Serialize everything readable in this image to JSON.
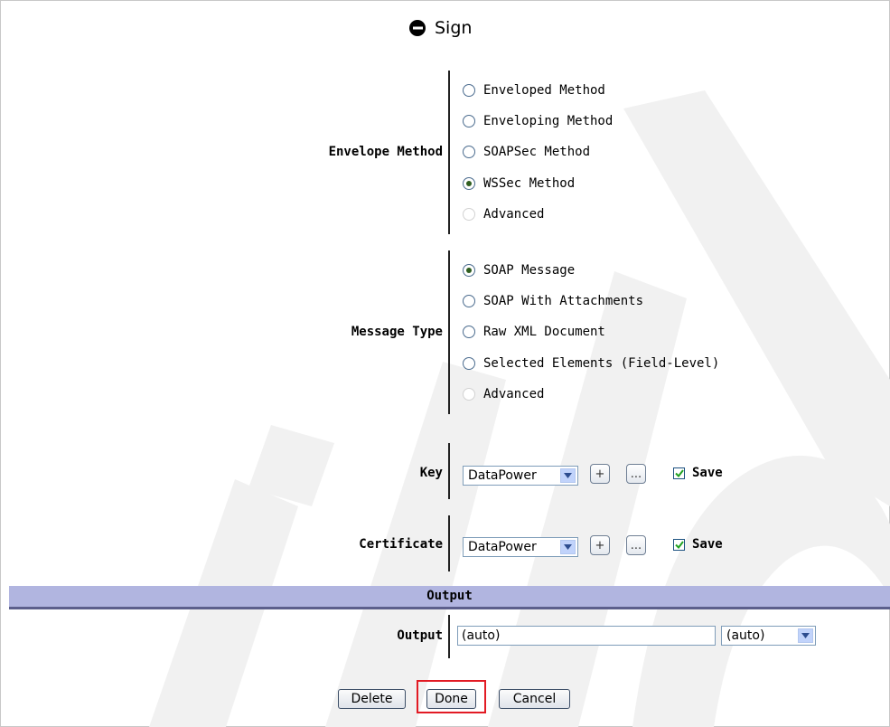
{
  "title": "Sign",
  "envelope": {
    "label": "Envelope Method",
    "options": [
      "Enveloped Method",
      "Enveloping Method",
      "SOAPSec Method",
      "WSSec Method",
      "Advanced"
    ],
    "selected": "WSSec Method"
  },
  "message": {
    "label": "Message Type",
    "options": [
      "SOAP Message",
      "SOAP With Attachments",
      "Raw XML Document",
      "Selected Elements (Field-Level)",
      "Advanced"
    ],
    "selected": "SOAP Message"
  },
  "key": {
    "label": "Key",
    "select_value": "DataPower",
    "add": "+",
    "edit": "...",
    "save_label": "Save",
    "save_checked": true
  },
  "certificate": {
    "label": "Certificate",
    "select_value": "DataPower",
    "add": "+",
    "edit": "...",
    "save_label": "Save",
    "save_checked": true
  },
  "output_section": {
    "header": "Output",
    "label": "Output",
    "input_value": "(auto)",
    "select_value": "(auto)"
  },
  "buttons": {
    "delete": "Delete",
    "done": "Done",
    "cancel": "Cancel"
  },
  "colors": {
    "section_bar": "#b1b5e0",
    "highlight": "#e21b24",
    "watermark": "#f2f2f2"
  }
}
